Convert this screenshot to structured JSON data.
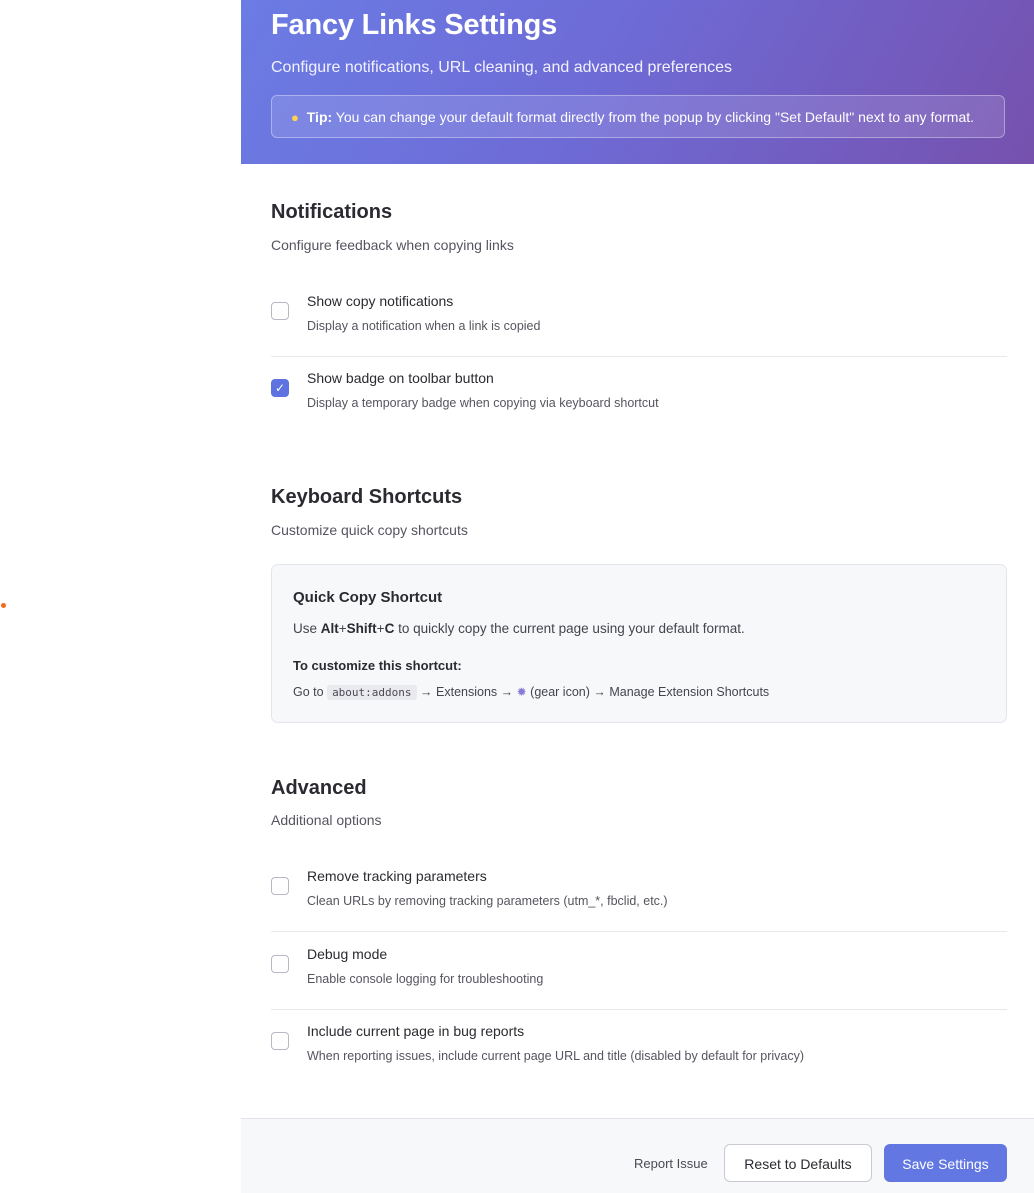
{
  "header": {
    "title": "Fancy Links Settings",
    "subtitle": "Configure notifications, URL cleaning, and advanced preferences",
    "tip_label": "Tip:",
    "tip_text": "You can change your default format directly from the popup by clicking \"Set Default\" next to any format.",
    "tip_icon": "lightbulb-icon"
  },
  "notifications": {
    "title": "Notifications",
    "description": "Configure feedback when copying links",
    "options": [
      {
        "label": "Show copy notifications",
        "description": "Display a notification when a link is copied",
        "checked": false
      },
      {
        "label": "Show badge on toolbar button",
        "description": "Display a temporary badge when copying via keyboard shortcut",
        "checked": true
      }
    ]
  },
  "shortcuts": {
    "title": "Keyboard Shortcuts",
    "description": "Customize quick copy shortcuts",
    "box_title": "Quick Copy Shortcut",
    "use_prefix": "Use",
    "key1": "Alt",
    "plus": "+",
    "key2": "Shift",
    "key3": "C",
    "use_suffix": "to quickly copy the current page using your default format.",
    "customize_title": "To customize this shortcut:",
    "path_prefix": "Go to",
    "path_code": "about:addons",
    "path_step1": "→ Extensions →",
    "path_step2": "(gear icon) → Manage Extension Shortcuts",
    "gear_icon": "gear-icon"
  },
  "advanced": {
    "title": "Advanced",
    "description": "Additional options",
    "options": [
      {
        "label": "Remove tracking parameters",
        "description": "Clean URLs by removing tracking parameters (utm_*, fbclid, etc.)",
        "checked": false
      },
      {
        "label": "Debug mode",
        "description": "Enable console logging for troubleshooting",
        "checked": false
      },
      {
        "label": "Include current page in bug reports",
        "description": "When reporting issues, include current page URL and title (disabled by default for privacy)",
        "checked": false
      }
    ]
  },
  "footer": {
    "report_label": "Report Issue",
    "reset_label": "Reset to Defaults",
    "save_label": "Save Settings"
  },
  "colors": {
    "accent": "#6377e2",
    "header_start": "#6b7ce4",
    "header_end": "#7651ae"
  }
}
